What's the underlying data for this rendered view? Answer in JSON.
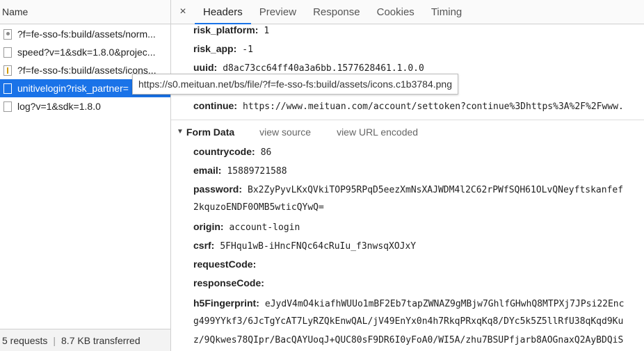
{
  "left": {
    "header": "Name",
    "requests": [
      {
        "name": "?f=fe-sso-fs:build/assets/norm...",
        "icon": "image-file-icon",
        "selected": false
      },
      {
        "name": "speed?v=1&sdk=1.8.0&projec...",
        "icon": "document-file-icon",
        "selected": false
      },
      {
        "name": "?f=fe-sso-fs:build/assets/icons...",
        "icon": "png-file-icon",
        "selected": false
      },
      {
        "name": "unitivelogin?risk_partner=",
        "icon": "document-file-icon",
        "selected": true
      },
      {
        "name": "log?v=1&sdk=1.8.0",
        "icon": "document-file-icon",
        "selected": false
      }
    ],
    "footer": {
      "requests": "5 requests",
      "separator": "|",
      "transferred": "8.7 KB transferred"
    }
  },
  "tabs": {
    "close": "×",
    "items": [
      "Headers",
      "Preview",
      "Response",
      "Cookies",
      "Timing"
    ],
    "active": "Headers"
  },
  "query_params": [
    {
      "key": "risk_platform:",
      "value": "1"
    },
    {
      "key": "risk_app:",
      "value": "-1"
    },
    {
      "key": "uuid:",
      "value": "d8ac73cc64ff40a3a6bb.1577628461.1.0.0"
    }
  ],
  "continue_param": {
    "key": "continue:",
    "value": "https://www.meituan.com/account/settoken?continue%3Dhttps%3A%2F%2Fwww."
  },
  "form_data": {
    "toggle": "▼",
    "title": "Form Data",
    "view_source": "view source",
    "view_url_encoded": "view URL encoded",
    "fields": [
      {
        "key": "countrycode:",
        "value": "86"
      },
      {
        "key": "email:",
        "value": "15889721588"
      },
      {
        "key": "password:",
        "value": "Bx2ZyPyvLKxQVkiTOP95RPqD5eezXmNsXAJWDM4l2C62rPWfSQH61OLvQNeyftskanfef"
      },
      {
        "key": "",
        "value": "2kquzoENDF0OMB5wticQYwQ="
      },
      {
        "key": "origin:",
        "value": "account-login"
      },
      {
        "key": "csrf:",
        "value": "5FHqu1wB-iHncFNQc64cRuIu_f3nwsqXOJxY"
      },
      {
        "key": "requestCode:",
        "value": ""
      },
      {
        "key": "responseCode:",
        "value": ""
      },
      {
        "key": "h5Fingerprint:",
        "value": "eJydV4mO4kiafhWUUo1mBF2Eb7tapZWNAZ9gMBjw7GhlfGHwhQ8MTPXj7JPsi22Enc"
      },
      {
        "key": "",
        "value": "g499YYkf3/6JcTgYcAT7LyRZQkEnwQAL/jV49EnYx0n4h7RkqPRxqKq8/DYc5k5Z5llRfU38qKqd9Ku"
      },
      {
        "key": "",
        "value": "z/9Qkwes78QIpr/BacQAYUoqJ+QUC80sF9DR6I0yFoA0/WI5A/zhu7BSUPfjarb8AOGnaxQ2AyBDQiS"
      }
    ]
  },
  "tooltip": "https://s0.meituan.net/bs/file/?f=fe-sso-fs:build/assets/icons.c1b3784.png"
}
